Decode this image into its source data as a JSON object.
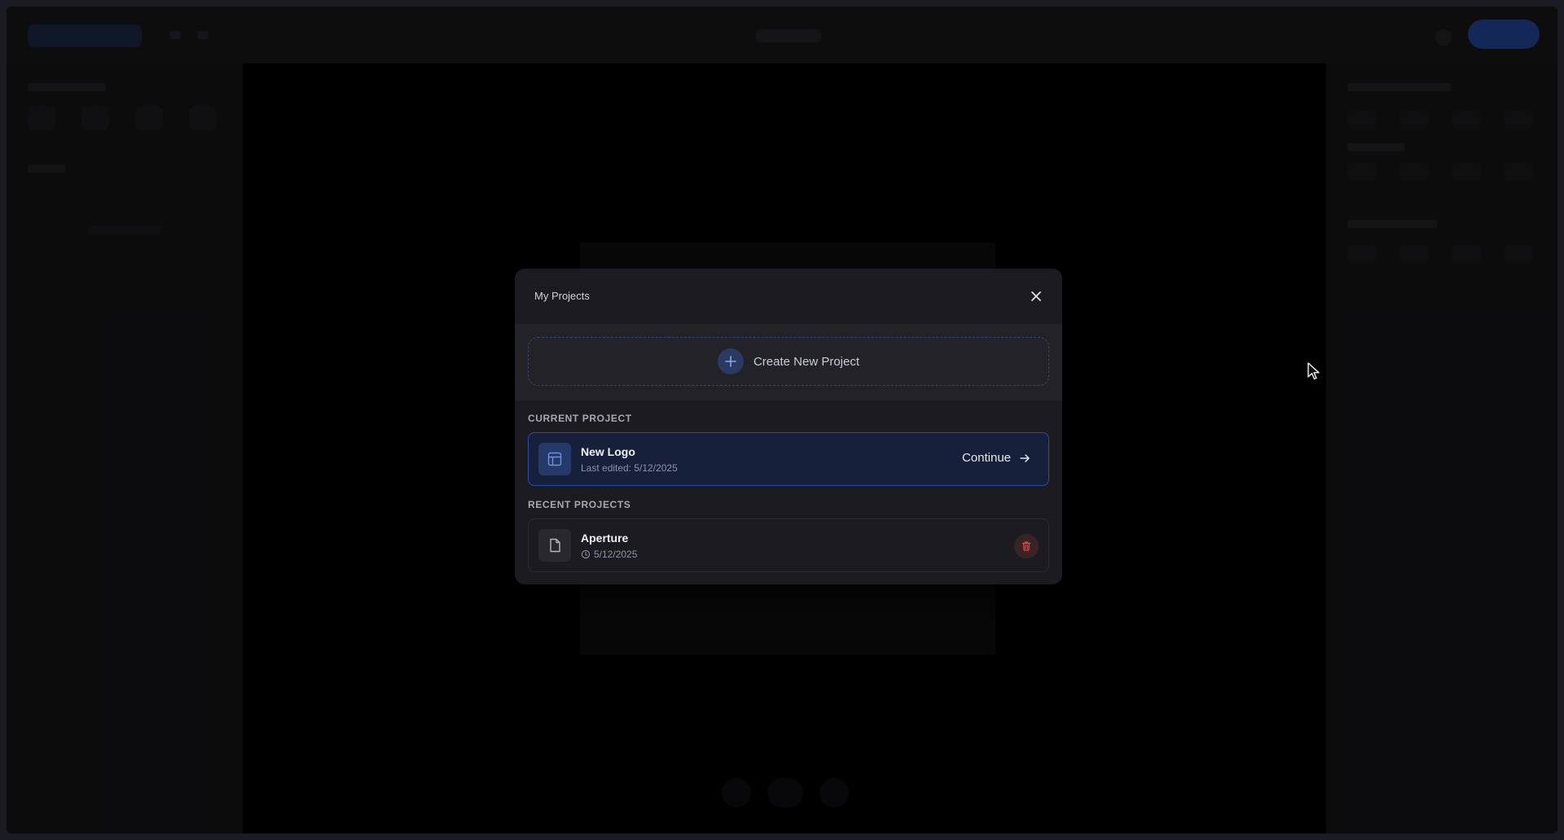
{
  "modal": {
    "title": "My Projects",
    "create_label": "Create New Project",
    "current_section_label": "CURRENT PROJECT",
    "recent_section_label": "RECENT PROJECTS",
    "current_project": {
      "name": "New Logo",
      "last_edited": "Last edited: 5/12/2025",
      "continue_label": "Continue"
    },
    "recent_projects": [
      {
        "name": "Aperture",
        "date": "5/12/2025"
      }
    ]
  },
  "colors": {
    "accent": "#2c4aa6",
    "danger": "#e5484d",
    "background": "#121214"
  }
}
